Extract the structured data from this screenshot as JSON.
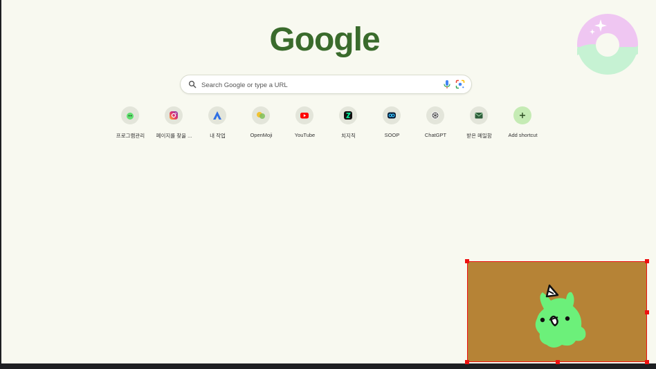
{
  "logo": {
    "text": "Google"
  },
  "search": {
    "placeholder": "Search Google or type a URL"
  },
  "icons": {
    "search": "search-icon",
    "voice": "mic-icon",
    "lens": "google-lens-icon",
    "add": "plus-icon"
  },
  "shortcuts": [
    {
      "label": "프로그램관리",
      "icon": "slime-favicon"
    },
    {
      "label": "페이지를 찾을 ...",
      "icon": "instagram-icon"
    },
    {
      "label": "내 작업",
      "icon": "triangle-a-icon"
    },
    {
      "label": "OpenMoji",
      "icon": "openmoji-icon"
    },
    {
      "label": "YouTube",
      "icon": "youtube-icon"
    },
    {
      "label": "치지직",
      "icon": "chzzk-icon"
    },
    {
      "label": "SOOP",
      "icon": "soop-icon"
    },
    {
      "label": "ChatGPT",
      "icon": "chatgpt-icon"
    },
    {
      "label": "받은 메일함",
      "icon": "mail-icon"
    },
    {
      "label": "Add shortcut",
      "icon": "plus-icon"
    }
  ],
  "colors": {
    "background": "#f8f9f0",
    "logo": "#3a6b2c",
    "overlay_fill": "#b68336",
    "overlay_border": "#ee1111",
    "mascot": "#6cf07a"
  }
}
